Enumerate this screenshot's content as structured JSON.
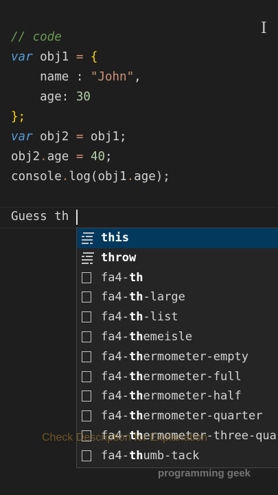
{
  "editor": {
    "lines": {
      "l1_comment": "// code",
      "l2_kw": "var",
      "l2_name": " obj1 ",
      "l2_eq": "=",
      "l2_brace": " {",
      "l3_key": "    name : ",
      "l3_val": "\"John\"",
      "l3_comma": ",",
      "l4_key": "    age: ",
      "l4_val": "30",
      "l5_close": "};",
      "l6_kw": "var",
      "l6_rest_a": " obj2 ",
      "l6_eq": "=",
      "l6_rest_b": " obj1;",
      "l7_a": "obj2",
      "l7_dot": ".",
      "l7_b": "age ",
      "l7_eq": "=",
      "l7_sp": " ",
      "l7_val": "40",
      "l7_semi": ";",
      "l8_a": "console",
      "l8_dot": ".",
      "l8_b": "log(obj1",
      "l8_dot2": ".",
      "l8_c": "age);",
      "l10_typed": "Guess th"
    }
  },
  "suggestions": [
    {
      "kind": "keyword",
      "match": "this",
      "rest": "",
      "prefix": "",
      "selected": true
    },
    {
      "kind": "keyword",
      "match": "throw",
      "rest": "",
      "prefix": "",
      "selected": false
    },
    {
      "kind": "snippet",
      "prefix": "fa4-",
      "match": "th",
      "rest": "",
      "selected": false
    },
    {
      "kind": "snippet",
      "prefix": "fa4-",
      "match": "th",
      "rest": "-large",
      "selected": false
    },
    {
      "kind": "snippet",
      "prefix": "fa4-",
      "match": "th",
      "rest": "-list",
      "selected": false
    },
    {
      "kind": "snippet",
      "prefix": "fa4-",
      "match": "th",
      "rest": "emeisle",
      "selected": false
    },
    {
      "kind": "snippet",
      "prefix": "fa4-",
      "match": "th",
      "rest": "ermometer-empty",
      "selected": false
    },
    {
      "kind": "snippet",
      "prefix": "fa4-",
      "match": "th",
      "rest": "ermometer-full",
      "selected": false
    },
    {
      "kind": "snippet",
      "prefix": "fa4-",
      "match": "th",
      "rest": "ermometer-half",
      "selected": false
    },
    {
      "kind": "snippet",
      "prefix": "fa4-",
      "match": "th",
      "rest": "ermometer-quarter",
      "selected": false
    },
    {
      "kind": "snippet",
      "prefix": "fa4-",
      "match": "th",
      "rest": "ermometer-three-quarters",
      "selected": false
    },
    {
      "kind": "snippet",
      "prefix": "fa4-",
      "match": "th",
      "rest": "umb-tack",
      "selected": false
    }
  ],
  "overlay": {
    "watermark": "Check Description for Explanation",
    "brand": "programming geek"
  },
  "colors": {
    "background": "#1e1e1e",
    "keyword": "#569cd6",
    "comment": "#6a9955",
    "string": "#ce9178",
    "number": "#b5cea8",
    "brace": "#ffd700",
    "suggest_bg": "#252526",
    "suggest_selected": "#04395e"
  }
}
